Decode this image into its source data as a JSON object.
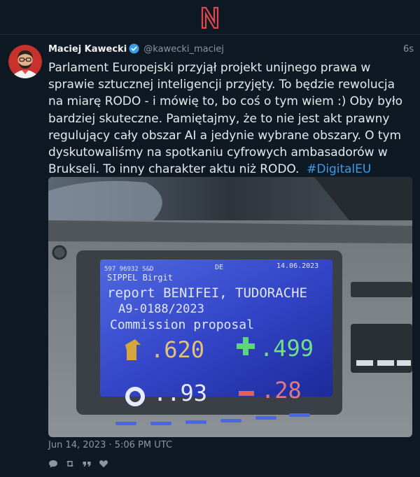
{
  "app": {
    "logo_letter": "N"
  },
  "tweet": {
    "author_name": "Maciej Kawecki",
    "author_handle": "@kawecki_maciej",
    "relative_time": "6s",
    "text": "Parlament Europejski przyjął projekt unijnego prawa w sprawie sztucznej inteligencji przyjęty. To będzie rewolucja na miarę RODO - i mówię to, bo coś o tym wiem :) Oby było bardziej skuteczne. Pamiętajmy, że to nie jest akt prawny regulujący cały obszar AI a jedynie wybrane obszary. O tym dyskutowaliśmy na spotkaniu cyfrowych ambasadorów w Brukseli. To inny charakter aktu niż RODO.",
    "hashtag": "#DigitalEU",
    "date": "Jun 14, 2023 · 5:06 PM UTC",
    "colors": {
      "accent": "#3a9ce8",
      "logo": "#e0484d",
      "background": "#0f1923"
    }
  },
  "media": {
    "screen": {
      "top_left": "597  96932  S&D",
      "top_mid": "DE",
      "date": "14.06.2023",
      "member": "SIPPEL Birgit",
      "line1": "report BENIFEI, TUDORACHE",
      "line2": "A9-0188/2023",
      "line3": "Commission proposal",
      "for": ".620",
      "against": ".499",
      "abstain": "..93",
      "minus": ".28"
    }
  },
  "icons": {
    "verified": "verified-badge-icon",
    "reply": "reply-icon",
    "retweet": "retweet-icon",
    "quote": "quote-icon",
    "like": "heart-icon"
  }
}
